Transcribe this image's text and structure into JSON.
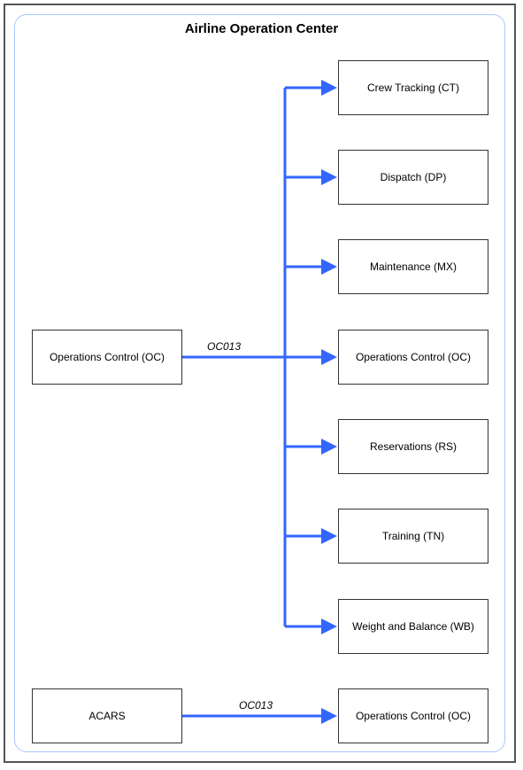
{
  "title": "Airline Operation Center",
  "source": {
    "label": "Operations Control (OC)"
  },
  "edge_main": {
    "label": "OC013"
  },
  "targets": [
    {
      "label": "Crew Tracking (CT)"
    },
    {
      "label": "Dispatch (DP)"
    },
    {
      "label": "Maintenance (MX)"
    },
    {
      "label": "Operations Control (OC)"
    },
    {
      "label": "Reservations (RS)"
    },
    {
      "label": "Training (TN)"
    },
    {
      "label": "Weight and Balance (WB)"
    }
  ],
  "acars": {
    "label": "ACARS"
  },
  "edge_acars": {
    "label": "OC013"
  },
  "acars_target": {
    "label": "Operations Control (OC)"
  },
  "colors": {
    "arrow": "#3366ff"
  }
}
